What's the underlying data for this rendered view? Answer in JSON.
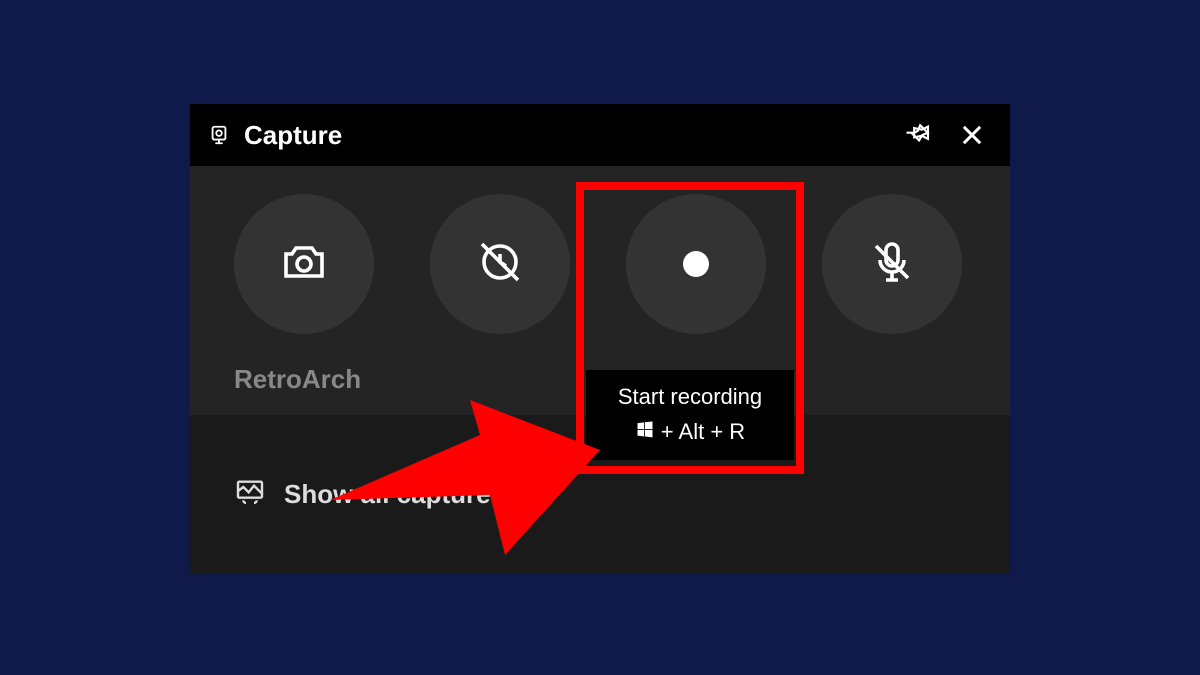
{
  "panel": {
    "title": "Capture",
    "app_name": "RetroArch",
    "show_all": "Show all captures"
  },
  "buttons": {
    "screenshot": "Take screenshot",
    "last30": "Record last 30 seconds",
    "record": "Start recording",
    "mic": "Turn mic on"
  },
  "tooltip": {
    "label": "Start recording",
    "shortcut_rest": " + Alt + R"
  },
  "colors": {
    "highlight": "#ff0000",
    "bg": "#0f1a4a"
  }
}
